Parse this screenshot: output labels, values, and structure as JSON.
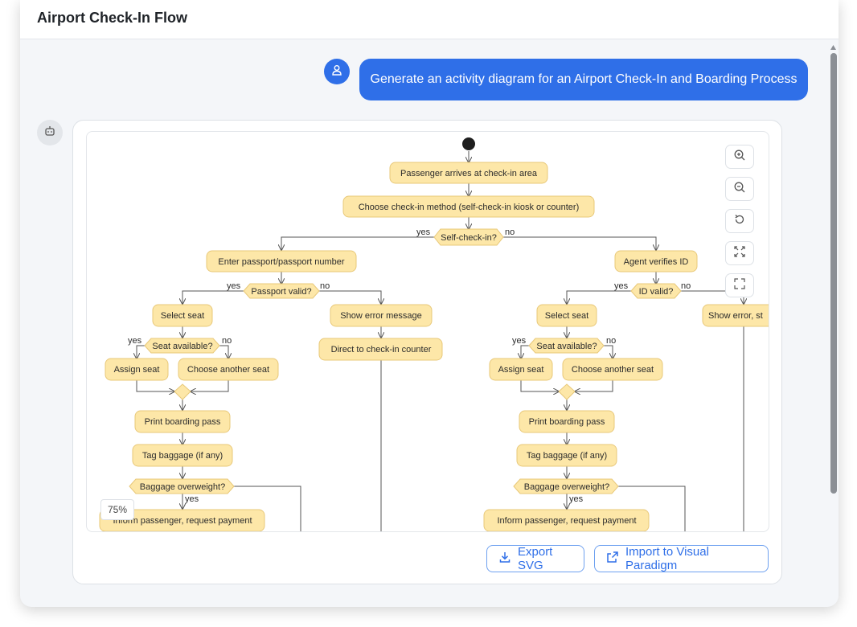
{
  "window": {
    "title": "Airport Check-In Flow"
  },
  "chat": {
    "user_message": "Generate an activity diagram for an Airport Check-In and Boarding Process",
    "user_icon": "user-icon",
    "bot_icon": "robot-icon"
  },
  "toolbar": {
    "zoom_in": "zoom-in-icon",
    "zoom_out": "zoom-out-icon",
    "reset": "reset-icon",
    "fit": "fit-view-icon",
    "fullscreen": "fullscreen-icon"
  },
  "zoom_level": "75%",
  "actions": {
    "export_label": "Export SVG",
    "import_label": "Import to Visual Paradigm"
  },
  "colors": {
    "accent": "#2f6fe8",
    "node_fill": "#fde7a8",
    "node_border": "#e8c879"
  },
  "diagram": {
    "arrive": "Passenger arrives at check-in area",
    "choose": "Choose check-in method (self-check-in kiosk or counter)",
    "self_q": "Self-check-in?",
    "yes": "yes",
    "no": "no",
    "enter_passport": "Enter passport/passport number",
    "agent_verifies": "Agent verifies ID",
    "passport_valid": "Passport valid?",
    "id_valid": "ID valid?",
    "select_seat": "Select seat",
    "show_error": "Show error message",
    "show_error_trunc": "Show error, st",
    "direct_counter": "Direct to check-in counter",
    "seat_available": "Seat available?",
    "assign_seat": "Assign seat",
    "choose_another": "Choose another seat",
    "print_pass": "Print boarding pass",
    "tag_baggage": "Tag baggage (if any)",
    "overweight": "Baggage overweight?",
    "inform": "Inform passenger, request payment"
  }
}
